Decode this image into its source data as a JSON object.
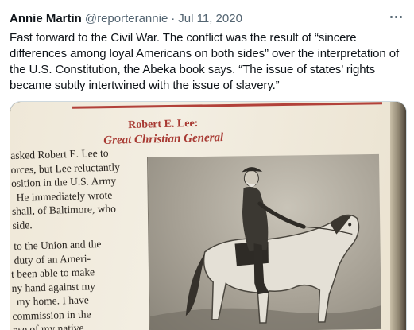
{
  "tweet": {
    "author_name": "Annie Martin",
    "author_handle": "@reporterannie",
    "separator": "·",
    "date": "Jul 11, 2020",
    "text_lines": [
      "Fast forward to the Civil War. The conflict was the result of “sincere",
      "differences among loyal Americans on both sides” over the interpretation of",
      "the U.S. Constitution, the Abeka book says. “The issue of states’ rights",
      "became subtly intertwined with the issue of slavery.”"
    ]
  },
  "book_page": {
    "heading_line1": "Robert E. Lee:",
    "heading_line2": "Great Christian General",
    "paragraph1_lines": [
      "asked Robert E. Lee to",
      "orces, but Lee reluctantly",
      "osition in the U.S. Army",
      "He immediately wrote",
      "shall, of Baltimore, who",
      "side."
    ],
    "paragraph2_lines": [
      "to the Union and the",
      "duty of an Ameri-",
      "t been able to make",
      "ny hand against my",
      "my home.  I have",
      "commission in the",
      "nse of my native"
    ]
  },
  "colors": {
    "heading_red": "#a83a33",
    "text_primary": "#0f1419",
    "text_secondary": "#536471"
  },
  "icons": {
    "more": "more-horizontal-icon"
  }
}
